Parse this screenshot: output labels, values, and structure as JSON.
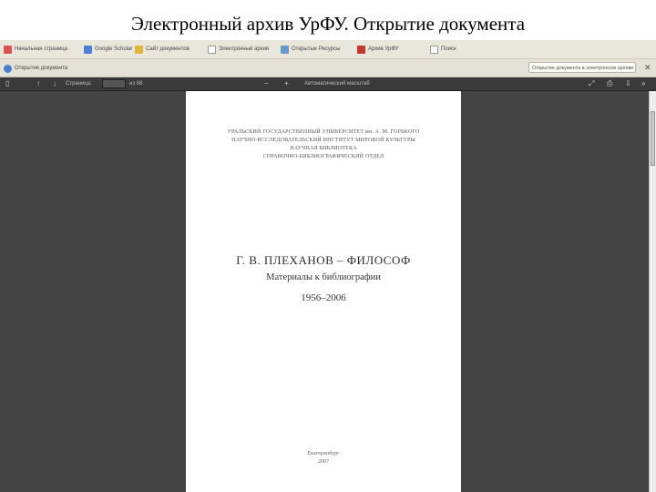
{
  "slide": {
    "title": "Электронный архив УрФУ. Открытие документа"
  },
  "bookmarks": [
    {
      "label": "Начальная страница",
      "color": "#d9534f"
    },
    {
      "label": "Google Scholar",
      "color": "#4a7fd4"
    },
    {
      "label": "Сайт документов",
      "color": "#e0b640"
    },
    {
      "label": "Электронный архив",
      "color": "#ffffff"
    },
    {
      "label": "Открытые Ресурсы",
      "color": "#6699cc"
    },
    {
      "label": "Архив УрФУ",
      "color": "#c0392b"
    },
    {
      "label": "Поиск",
      "color": "#ffffff"
    }
  ],
  "tab": {
    "label": "Открытие документа",
    "address": "Открытие документа в электронном архиве"
  },
  "toolbar": {
    "page_label": "Страница:",
    "page_total": "из 68",
    "zoom": "Автоматический масштаб"
  },
  "document": {
    "institution": [
      "УРАЛЬСКИЙ ГОСУДАРСТВЕННЫЙ УНИВЕРСИТЕТ им. А. М. ГОРЬКОГО",
      "НАУЧНО-ИССЛЕДОВАТЕЛЬСКИЙ ИНСТИТУТ МИРОВОЙ КУЛЬТУРЫ",
      "НАУЧНАЯ БИБЛИОТЕКА",
      "СПРАВОЧНО-БИБЛИОГРАФИЧЕСКИЙ ОТДЕЛ"
    ],
    "title": "Г. В. ПЛЕХАНОВ – ФИЛОСОФ",
    "subtitle": "Материалы к библиографии",
    "years": "1956–2006",
    "city": "Екатеринбург",
    "year": "2007"
  }
}
